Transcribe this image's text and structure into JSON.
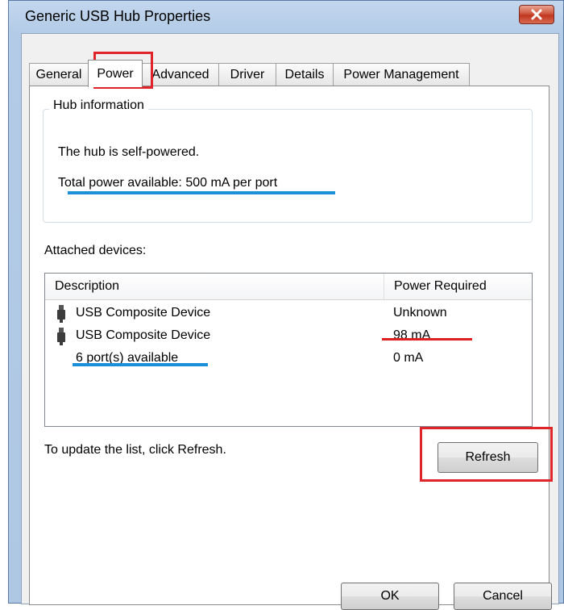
{
  "window": {
    "title": "Generic USB Hub Properties"
  },
  "tabs": [
    {
      "label": "General"
    },
    {
      "label": "Power"
    },
    {
      "label": "Advanced"
    },
    {
      "label": "Driver"
    },
    {
      "label": "Details"
    },
    {
      "label": "Power Management"
    }
  ],
  "active_tab": "Power",
  "hub_info": {
    "group_label": "Hub information",
    "powered_text": "The hub is self-powered.",
    "total_power_text": "Total power available:  500 mA per port"
  },
  "attached": {
    "label": "Attached devices:",
    "columns": [
      "Description",
      "Power Required"
    ],
    "rows": [
      {
        "description": "USB Composite Device",
        "power": "Unknown",
        "icon": "usb-plug-icon"
      },
      {
        "description": "USB Composite Device",
        "power": "98 mA",
        "icon": "usb-plug-icon"
      },
      {
        "description": "6 port(s) available",
        "power": "0 mA",
        "icon": ""
      }
    ]
  },
  "refresh": {
    "hint": "To update the list, click Refresh.",
    "button_label": "Refresh"
  },
  "footer": {
    "ok_label": "OK",
    "cancel_label": "Cancel"
  },
  "colors": {
    "annotation_red": "#e0242a",
    "annotation_blue": "#1b8fd9",
    "close_button": "#c0361f"
  }
}
